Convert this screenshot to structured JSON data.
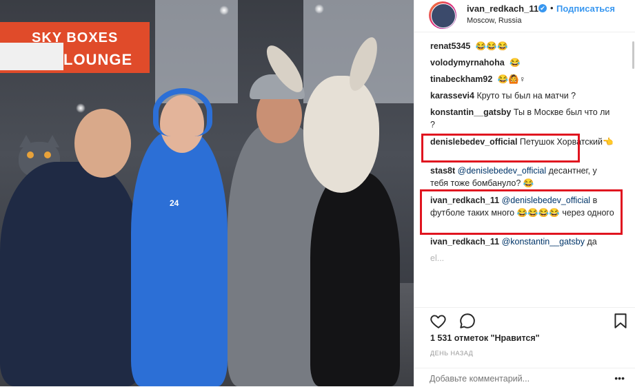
{
  "photo": {
    "sign_line1": "SKY BOXES",
    "sign_line2": "LOUNGE",
    "jersey_number": "24"
  },
  "header": {
    "username": "ivan_redkach_11",
    "verified_mark": "✔",
    "separator": "•",
    "follow_label": "Подписаться",
    "location": "Moscow, Russia"
  },
  "comments": [
    {
      "user": "renat5345",
      "mention": "",
      "text": ""
    },
    {
      "user": "volodymyrnahoha",
      "mention": "",
      "text": ""
    },
    {
      "user": "tinabeckham92",
      "mention": "",
      "text": "♀"
    },
    {
      "user": "karassevi4",
      "mention": "",
      "text": "Круто ты был на матчи ?"
    },
    {
      "user": "konstantin__gatsby",
      "mention": "",
      "text": "Ты в Москве был что ли ?"
    },
    {
      "user": "denislebedev_official",
      "mention": "",
      "text": "Петушок Хорватский👈"
    },
    {
      "user": "stas8t",
      "mention": "@denislebedev_official",
      "text": "десантнег, у тебя тоже бомбануло?"
    },
    {
      "user": "ivan_redkach_11",
      "mention": "@denislebedev_official",
      "text": "в футболе таких много",
      "text2": "через одного"
    },
    {
      "user": "ivan_redkach_11",
      "mention": "@konstantin__gatsby",
      "text": "да"
    }
  ],
  "faded_comment": {
    "text": "el..."
  },
  "actions": {
    "like_icon": "heart-icon",
    "comment_icon": "speech-bubble-icon",
    "save_icon": "bookmark-icon"
  },
  "likes_text": "1 531 отметок \"Нравится\"",
  "time_text": "ДЕНЬ НАЗАД",
  "add_comment": {
    "placeholder": "Добавьте комментарий...",
    "more": "•••"
  },
  "colors": {
    "accent": "#3897f0",
    "highlight": "#e0141f",
    "sign": "#e04b2a"
  }
}
